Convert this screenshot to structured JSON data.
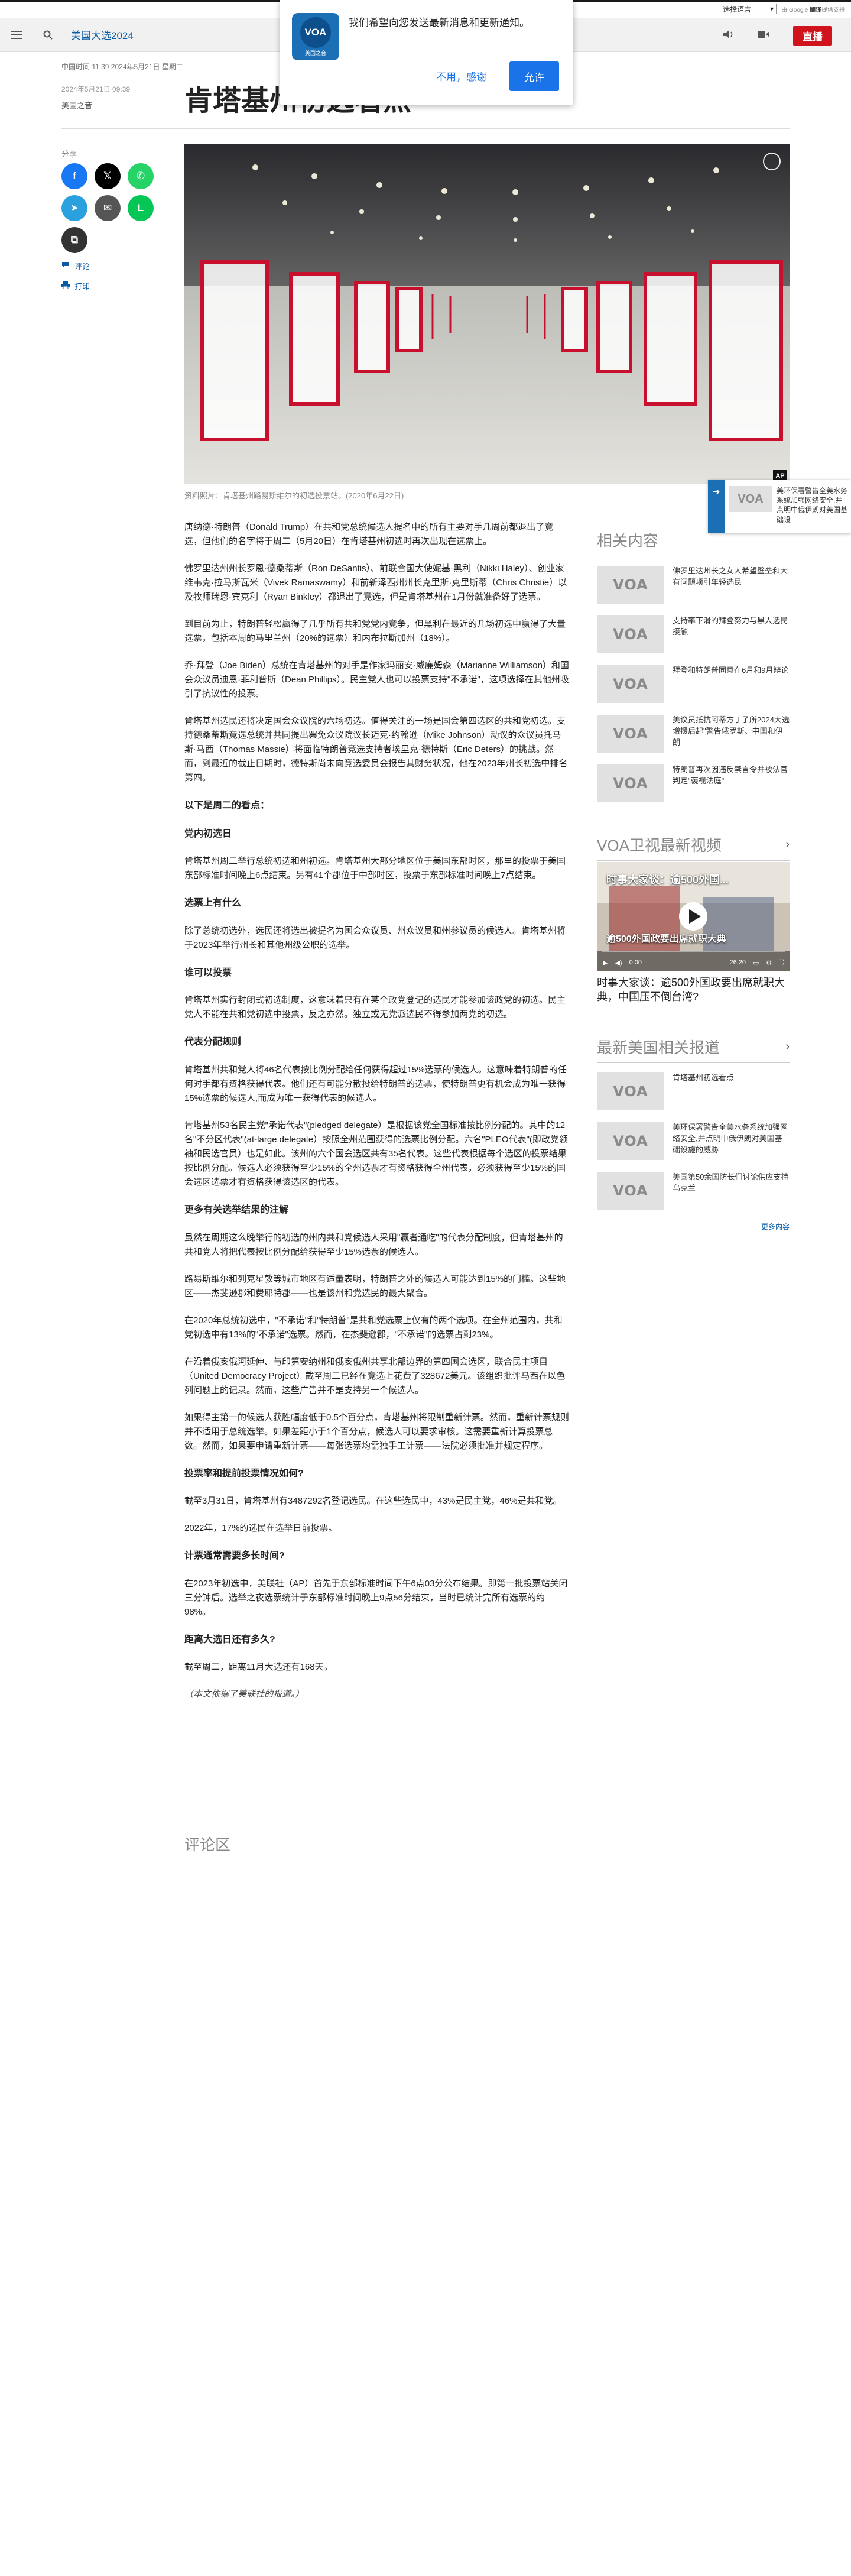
{
  "lang_bar": {
    "select_value": "选择语言",
    "gt_label": "由 Google",
    "gt_brand": "翻译",
    "gt_suffix": "提供支持"
  },
  "header": {
    "section": "美国大选2024",
    "live": "直播"
  },
  "notification": {
    "logo_text": "VOA",
    "logo_sub": "美国之音",
    "message": "我们希望向您发送最新消息和更新通知。",
    "decline": "不用，感谢",
    "accept": "允许"
  },
  "article_meta": {
    "dateline": "中国时间 11:39 2024年5月21日 星期二",
    "date2": "2024年5月21日 09:39",
    "category": "美国之音",
    "title": "肯塔基州初选看点"
  },
  "share": {
    "label": "分享",
    "buttons": [
      {
        "name": "facebook",
        "glyph": "f",
        "color": "#1877f2"
      },
      {
        "name": "x",
        "glyph": "𝕏",
        "color": "#000000"
      },
      {
        "name": "whatsapp",
        "glyph": "✆",
        "color": "#25d366"
      },
      {
        "name": "telegram",
        "glyph": "➤",
        "color": "#2aa1de"
      },
      {
        "name": "email",
        "glyph": "✉",
        "color": "#555555"
      },
      {
        "name": "line",
        "glyph": "L",
        "color": "#06c755"
      },
      {
        "name": "copy-link",
        "glyph": "⧉",
        "color": "#333333"
      }
    ],
    "comments": "评论",
    "print": "打印"
  },
  "hero": {
    "caption": "资料照片：肯塔基州路易斯维尔的初选投票站。(2020年6月22日)",
    "badge": "AP"
  },
  "body": [
    {
      "t": "p",
      "text": "唐纳德·特朗普（Donald Trump）在共和党总统候选人提名中的所有主要对手几周前都退出了竞选，但他们的名字将于周二（5月20日）在肯塔基州初选时再次出现在选票上。"
    },
    {
      "t": "p",
      "text": "佛罗里达州州长罗恩·德桑蒂斯（Ron DeSantis）、前联合国大使妮基·黑利（Nikki Haley）、创业家维韦克·拉马斯瓦米（Vivek Ramaswamy）和前新泽西州州长克里斯·克里斯蒂（Chris Christie）以及牧师瑞恩·宾克利（Ryan Binkley）都退出了竞选，但是肯塔基州在1月份就准备好了选票。"
    },
    {
      "t": "p",
      "text": "到目前为止，特朗普轻松赢得了几乎所有共和党党内竞争，但黑利在最近的几场初选中赢得了大量选票，包括本周的马里兰州（20%的选票）和内布拉斯加州（18%）。"
    },
    {
      "t": "p",
      "text": "乔·拜登（Joe Biden）总统在肯塔基州的对手是作家玛丽安·威廉姆森（Marianne Williamson）和国会众议员迪恩·菲利普斯（Dean Phillips）。民主党人也可以投票支持\"不承诺\"，这项选择在其他州吸引了抗议性的投票。"
    },
    {
      "t": "p",
      "text": "肯塔基州选民还将决定国会众议院的六场初选。值得关注的一场是国会第四选区的共和党初选。支持德桑蒂斯竞选总统并共同提出罢免众议院议长迈克·约翰逊（Mike Johnson）动议的众议员托马斯·马西（Thomas Massie）将面临特朗普竞选支持者埃里克·德特斯（Eric Deters）的挑战。然而，到最近的截止日期时，德特斯尚未向竞选委员会报告其财务状况，他在2023年州长初选中排名第四。"
    },
    {
      "t": "h3",
      "text": "以下是周二的看点："
    },
    {
      "t": "h3",
      "text": "党内初选日"
    },
    {
      "t": "p",
      "text": "肯塔基州周二举行总统初选和州初选。肯塔基州大部分地区位于美国东部时区，那里的投票于美国东部标准时间晚上6点结束。另有41个郡位于中部时区，投票于东部标准时间晚上7点结束。"
    },
    {
      "t": "h3",
      "text": "选票上有什么"
    },
    {
      "t": "p",
      "text": "除了总统初选外，选民还将选出被提名为国会众议员、州众议员和州参议员的候选人。肯塔基州将于2023年举行州长和其他州级公职的选举。"
    },
    {
      "t": "h3",
      "text": "谁可以投票"
    },
    {
      "t": "p",
      "text": "肯塔基州实行封闭式初选制度，这意味着只有在某个政党登记的选民才能参加该政党的初选。民主党人不能在共和党初选中投票，反之亦然。独立或无党派选民不得参加两党的初选。"
    },
    {
      "t": "h3",
      "text": "代表分配规则"
    },
    {
      "t": "p",
      "text": "肯塔基州共和党人将46名代表按比例分配给任何获得超过15%选票的候选人。这意味着特朗普的任何对手都有资格获得代表。他们还有可能分散投给特朗普的选票，使特朗普更有机会成为唯一获得15%选票的候选人,而成为唯一获得代表的候选人。"
    },
    {
      "t": "p",
      "text": "肯塔基州53名民主党\"承诺代表\"(pledged delegate）是根据该党全国标准按比例分配的。其中的12名\"不分区代表\"(at-large delegate）按照全州范围获得的选票比例分配。六名\"PLEO代表\"(即政党领袖和民选官员）也是如此。该州的六个国会选区共有35名代表。这些代表根据每个选区的投票结果按比例分配。候选人必须获得至少15%的全州选票才有资格获得全州代表，必须获得至少15%的国会选区选票才有资格获得该选区的代表。"
    },
    {
      "t": "h3",
      "text": "更多有关选举结果的注解"
    },
    {
      "t": "p",
      "text": "虽然在周期这么晚举行的初选的州内共和党候选人采用\"赢者通吃\"的代表分配制度，但肯塔基州的共和党人将把代表按比例分配给获得至少15%选票的候选人。"
    },
    {
      "t": "p",
      "text": "路易斯维尔和列克星敦等城市地区有适量表明，特朗普之外的候选人可能达到15%的门槛。这些地区——杰斐逊郡和费耶特郡——也是该州和党选民的最大聚合。"
    },
    {
      "t": "p",
      "text": "在2020年总统初选中，\"不承诺\"和\"特朗普\"是共和党选票上仅有的两个选项。在全州范围内，共和党初选中有13%的\"不承诺\"选票。然而，在杰斐逊郡，\"不承诺\"的选票占到23%。"
    },
    {
      "t": "p",
      "text": "在沿着俄亥俄河延伸、与印第安纳州和俄亥俄州共享北部边界的第四国会选区，联合民主项目（United Democracy Project）截至周二已经在竞选上花费了328672美元。该组织批评马西在以色列问题上的记录。然而，这些广告并不是支持另一个候选人。"
    },
    {
      "t": "p",
      "text": "如果得主第一的候选人获胜幅度低于0.5个百分点，肯塔基州将限制重新计票。然而，重新计票规则并不适用于总统选举。如果差距小于1个百分点，候选人可以要求审核。这需要重新计算投票总数。然而，如果要申请重新计票——每张选票均需独手工计票——法院必须批准并规定程序。"
    },
    {
      "t": "h3",
      "text": "投票率和提前投票情况如何?"
    },
    {
      "t": "p",
      "text": "截至3月31日，肯塔基州有3487292名登记选民。在这些选民中，43%是民主党，46%是共和党。"
    },
    {
      "t": "p",
      "text": "2022年，17%的选民在选举日前投票。"
    },
    {
      "t": "h3",
      "text": "计票通常需要多长时间?"
    },
    {
      "t": "p",
      "text": "在2023年初选中，美联社（AP）首先于东部标准时间下午6点03分公布结果。即第一批投票站关闭三分钟后。选举之夜选票统计于东部标准时间晚上9点56分结束，当时已统计完所有选票的约98%。"
    },
    {
      "t": "h3",
      "text": "距离大选日还有多久?"
    },
    {
      "t": "p",
      "text": "截至周二，距离11月大选还有168天。"
    },
    {
      "t": "note",
      "text": "（本文依据了美联社的报道。）"
    }
  ],
  "comments_heading": "评论区",
  "related": {
    "heading": "相关内容",
    "items": [
      "佛罗里达州长之女人希望壁垒和大有问题项引年轻选民",
      "支持率下滑的拜登努力与黑人选民接触",
      "拜登和特朗普同意在6月和9月辩论",
      "美议员抵抗阿蒂方丁子所2024大选 增援后起\"警告俄罗斯、中国和伊朗",
      "特朗普再次因违反禁言令并被法官判定\"藐视法庭\""
    ]
  },
  "video_section": {
    "heading": "VOA卫视最新视频",
    "overlay_top": "时事大家谈：逾500外国...",
    "overlay_bottom": "逾500外国政要出席就职大典",
    "time": "0:00",
    "duration": "26:20",
    "title": "时事大家谈：逾500外国政要出席就职大典，中国压不倒台湾?"
  },
  "latest": {
    "heading": "最新美国相关报道",
    "items": [
      "肯塔基州初选看点",
      "美环保署警告全美水务系统加强网络安全,并点明中俄伊朗对美国基础设施的威胁",
      "美国第50余国防长们讨论供应支持乌克兰"
    ],
    "more": "更多内容"
  },
  "float_panel": {
    "text": "美环保署警告全美水务系统加强网络安全,并点明中俄伊朗对美国基础设"
  },
  "colors": {
    "brand_blue": "#1a6fb5",
    "live_red": "#d0131c",
    "link_blue": "#0a5ba6"
  }
}
